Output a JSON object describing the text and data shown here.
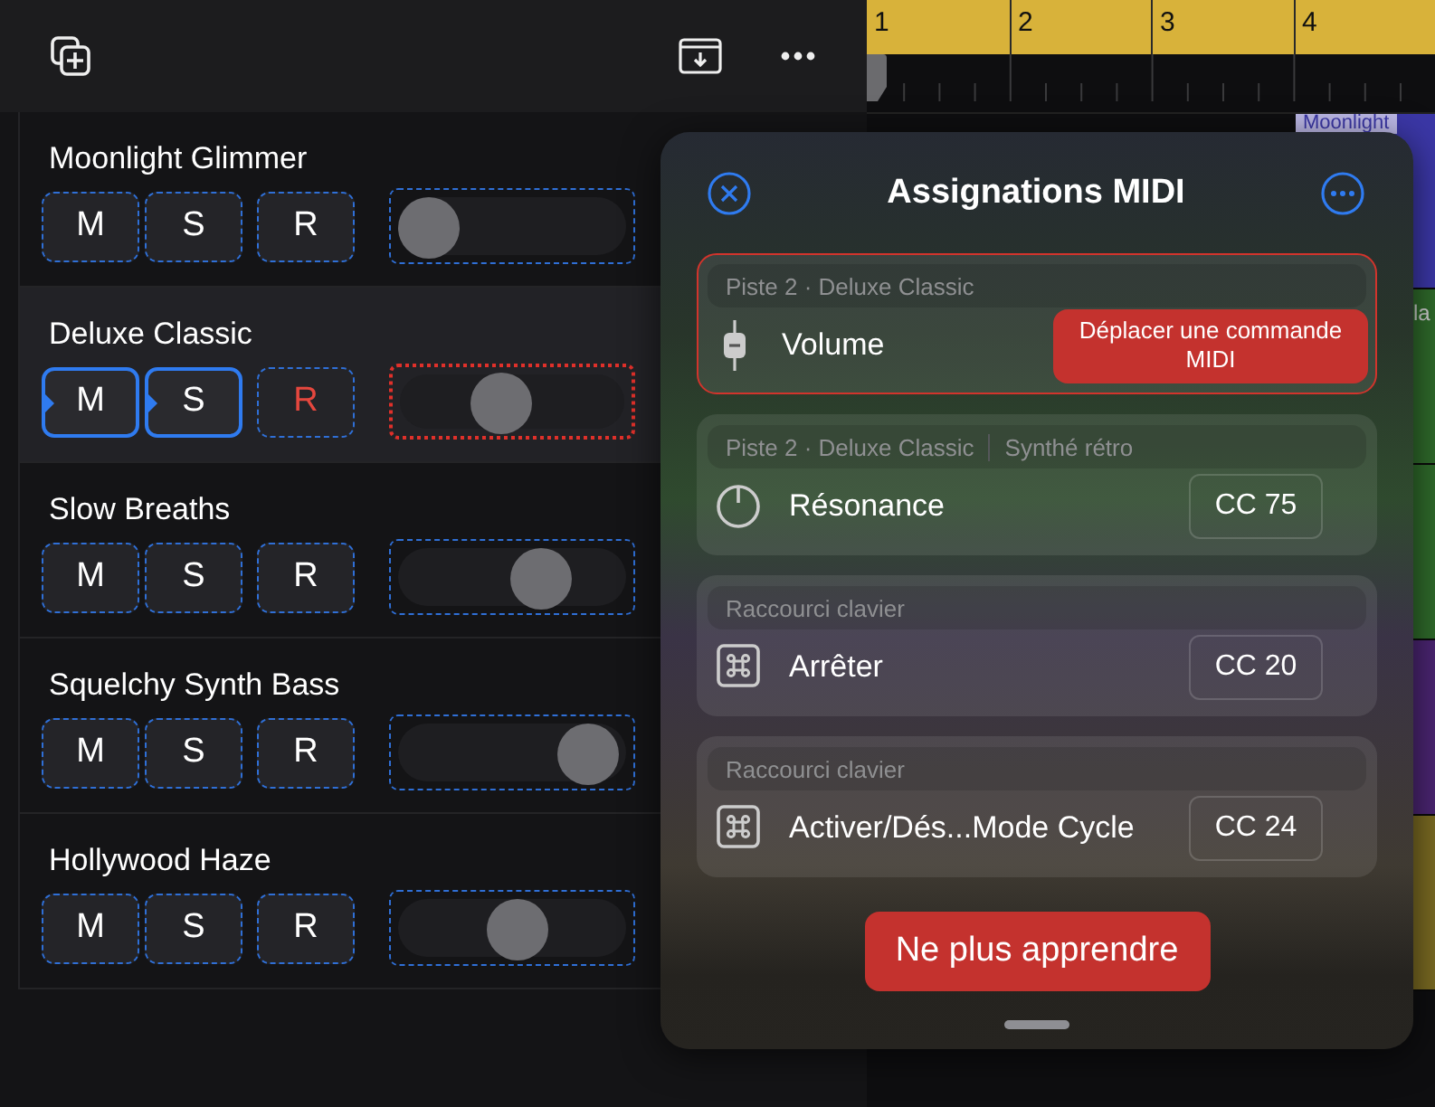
{
  "ruler": {
    "bars": [
      "1",
      "2",
      "3",
      "4"
    ]
  },
  "tracks": [
    {
      "name": "Moonlight Glimmer",
      "selected": false,
      "buttons": [
        {
          "label": "M",
          "assigned": false,
          "active": false
        },
        {
          "label": "S",
          "assigned": false,
          "active": false
        },
        {
          "label": "R",
          "assigned": false,
          "active": false
        }
      ],
      "volume": {
        "level": 0,
        "learning": false
      }
    },
    {
      "name": "Deluxe Classic",
      "selected": true,
      "buttons": [
        {
          "label": "M",
          "assigned": true,
          "active": false
        },
        {
          "label": "S",
          "assigned": true,
          "active": false
        },
        {
          "label": "R",
          "assigned": false,
          "active": true
        }
      ],
      "volume": {
        "level": 0.44,
        "learning": true
      }
    },
    {
      "name": "Slow Breaths",
      "selected": false,
      "buttons": [
        {
          "label": "M",
          "assigned": false,
          "active": false
        },
        {
          "label": "S",
          "assigned": false,
          "active": false
        },
        {
          "label": "R",
          "assigned": false,
          "active": false
        }
      ],
      "volume": {
        "level": 0.7,
        "learning": false
      }
    },
    {
      "name": "Squelchy Synth Bass",
      "selected": false,
      "buttons": [
        {
          "label": "M",
          "assigned": false,
          "active": false
        },
        {
          "label": "S",
          "assigned": false,
          "active": false
        },
        {
          "label": "R",
          "assigned": false,
          "active": false
        }
      ],
      "volume": {
        "level": 1,
        "learning": false
      }
    },
    {
      "name": "Hollywood Haze",
      "selected": false,
      "buttons": [
        {
          "label": "M",
          "assigned": false,
          "active": false
        },
        {
          "label": "S",
          "assigned": false,
          "active": false
        },
        {
          "label": "R",
          "assigned": false,
          "active": false
        }
      ],
      "volume": {
        "level": 0.56,
        "learning": false
      }
    }
  ],
  "lanes": [
    {
      "color": "#3b37a6",
      "label": "Moonlight"
    },
    {
      "color": "#2f6a2b",
      "label": "la"
    },
    {
      "color": "#2f6a2b"
    },
    {
      "color": "#4b2572"
    },
    {
      "color": "#7a6a22"
    }
  ],
  "popover": {
    "title": "Assignations MIDI",
    "cards": [
      {
        "context": [
          "Piste 2 · Deluxe Classic"
        ],
        "kind": "fader",
        "label": "Volume",
        "highlighted": true,
        "message": "Déplacer une commande MIDI"
      },
      {
        "context": [
          "Piste 2 · Deluxe Classic",
          "Synthé rétro"
        ],
        "kind": "knob",
        "label": "Résonance",
        "highlighted": false,
        "cc": "CC 75"
      },
      {
        "context": [
          "Raccourci clavier"
        ],
        "kind": "command",
        "label": "Arrêter",
        "highlighted": false,
        "cc": "CC 20"
      },
      {
        "context": [
          "Raccourci clavier"
        ],
        "kind": "command",
        "label": "Activer/Dés...Mode Cycle",
        "highlighted": false,
        "cc": "CC 24"
      }
    ],
    "button": "Ne plus apprendre"
  }
}
